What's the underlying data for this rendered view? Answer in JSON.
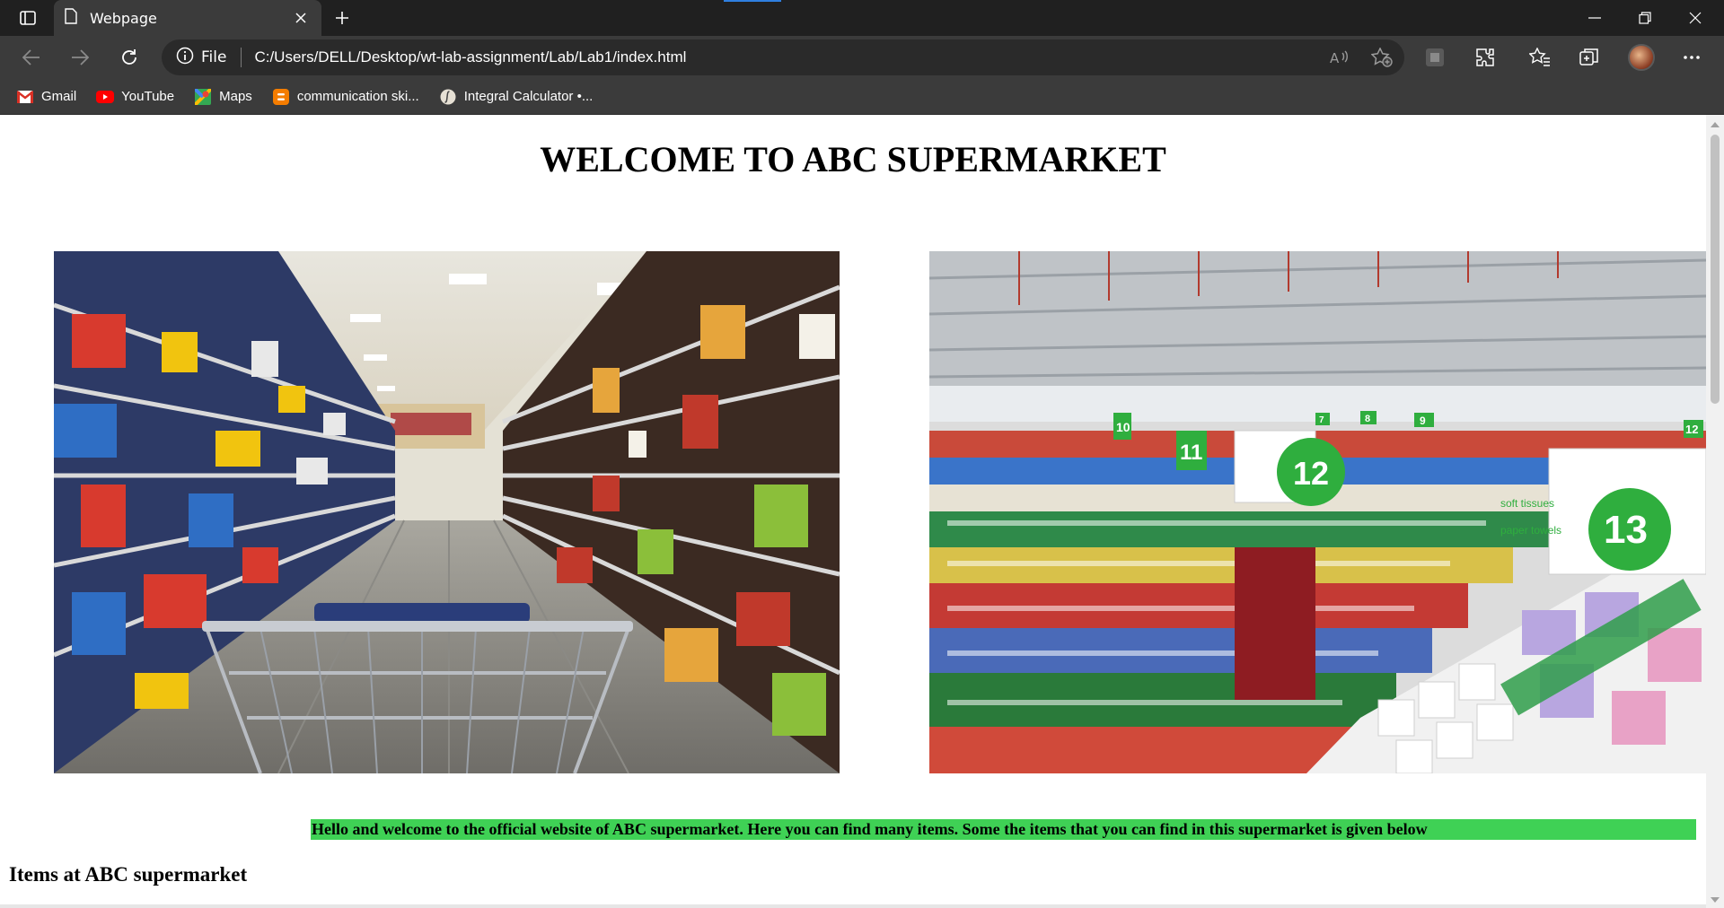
{
  "browser": {
    "tab_title": "Webpage",
    "address_scheme_label": "File",
    "url": "C:/Users/DELL/Desktop/wt-lab-assignment/Lab/Lab1/index.html",
    "bookmarks": [
      {
        "label": "Gmail",
        "icon": "gmail-icon"
      },
      {
        "label": "YouTube",
        "icon": "youtube-icon"
      },
      {
        "label": "Maps",
        "icon": "maps-icon"
      },
      {
        "label": "communication ski...",
        "icon": "blogger-icon"
      },
      {
        "label": "Integral Calculator •...",
        "icon": "calculator-icon"
      }
    ]
  },
  "page": {
    "title": "WELCOME TO ABC SUPERMARKET",
    "welcome_text": "Hello and welcome to the official website of ABC supermarket. Here you can find many items. Some the items that you can find in this supermarket is given below",
    "items_heading": "Items at ABC supermarket",
    "photo_left_alt": "supermarket aisle with shopping cart",
    "photo_right_alt": "supermarket overview with aisle signs",
    "aisle_signs": [
      "10",
      "11",
      "12",
      "13",
      "9",
      "8",
      "7",
      "12"
    ],
    "sign_text": [
      "soft tissues",
      "paper towels"
    ]
  },
  "colors": {
    "highlight": "#3fd155",
    "chrome_dark": "#202020",
    "chrome_mid": "#3b3b3b"
  }
}
